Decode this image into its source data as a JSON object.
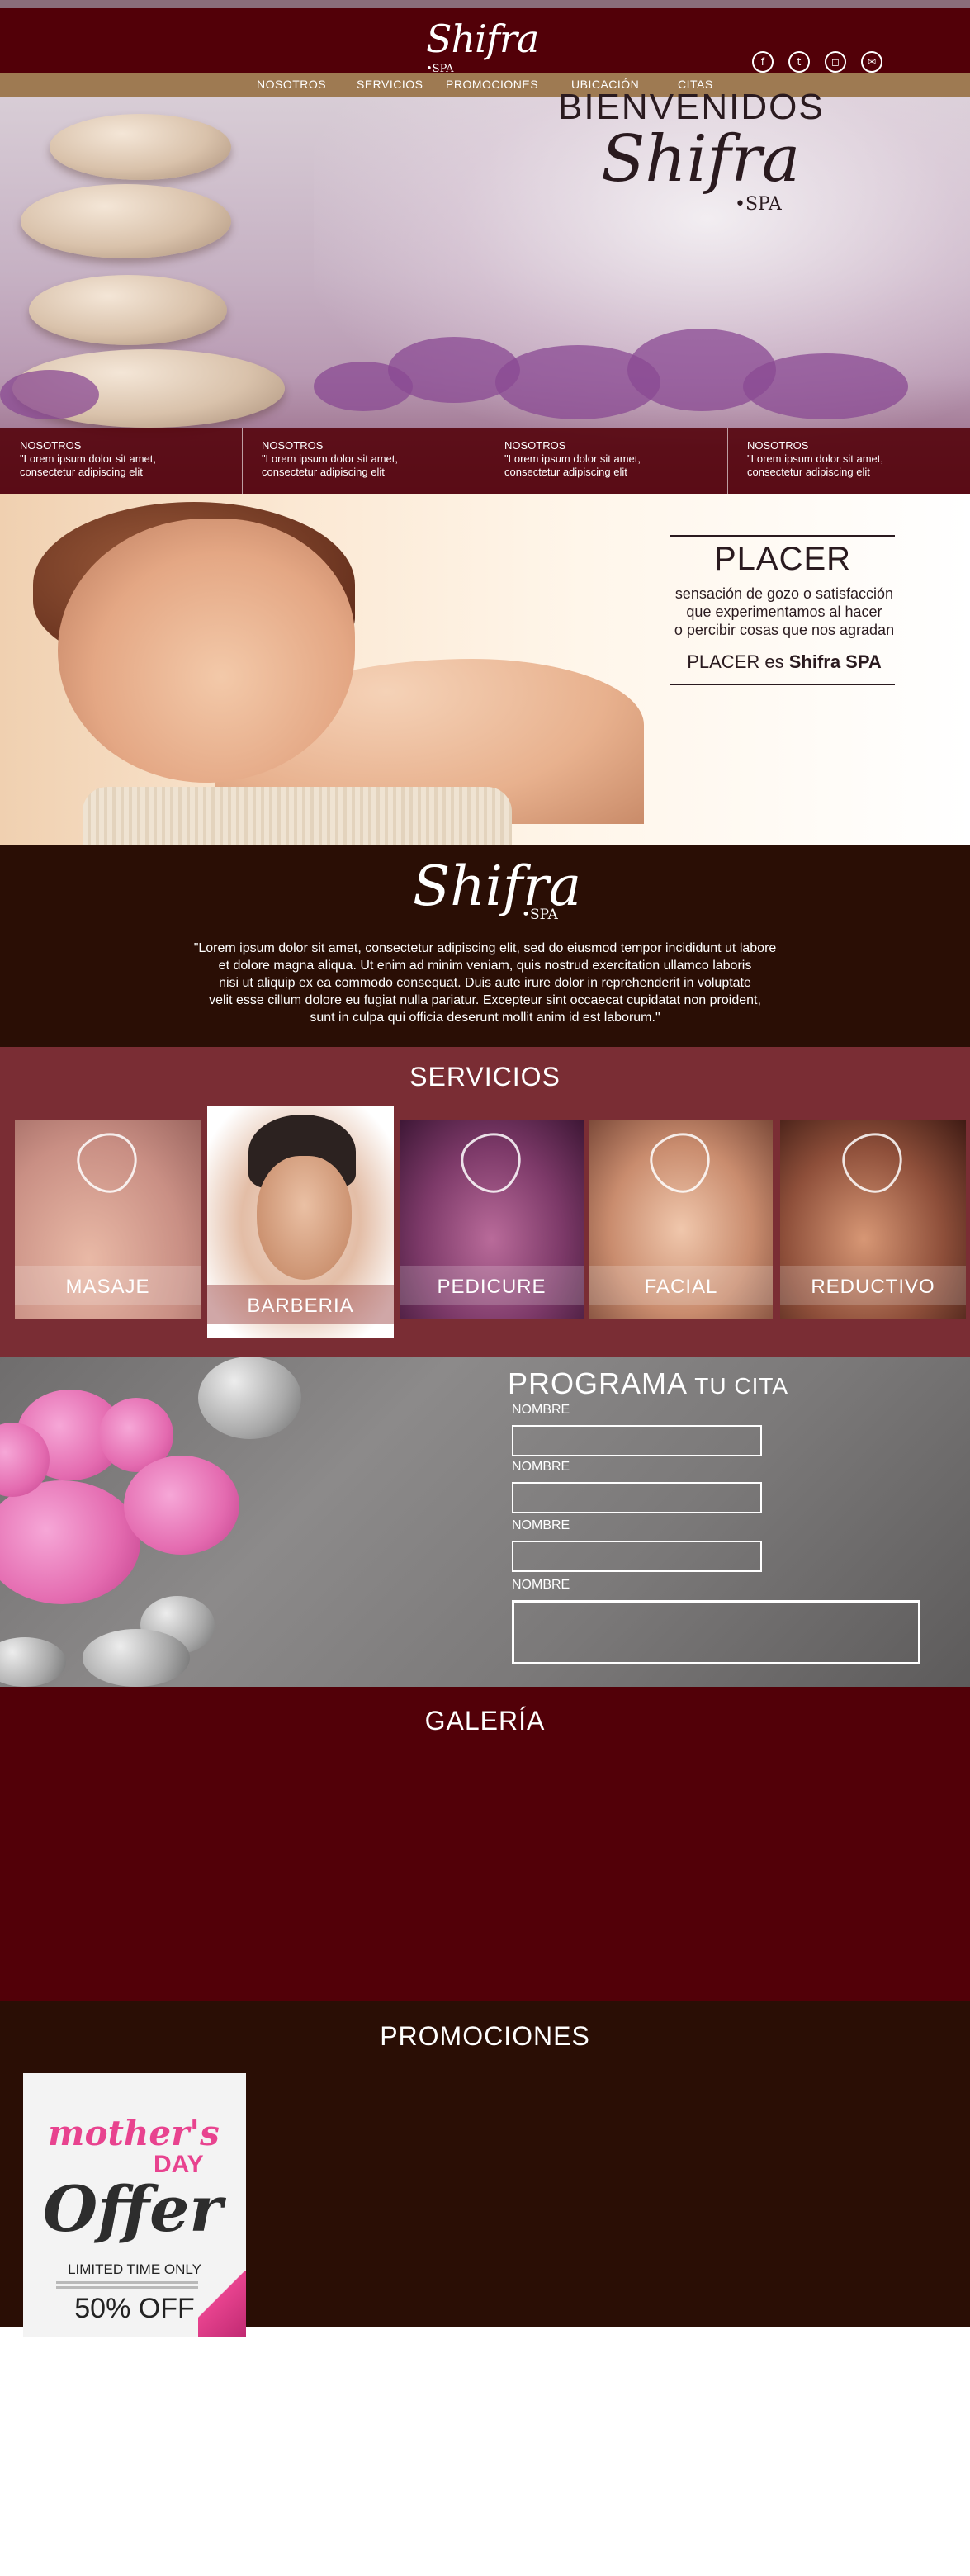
{
  "brand": {
    "name": "Shifra",
    "sub": "•SPA"
  },
  "nav": {
    "items": [
      {
        "label": "NOSOTROS"
      },
      {
        "label": "SERVICIOS"
      },
      {
        "label": "PROMOCIONES"
      },
      {
        "label": "UBICACIÓN"
      },
      {
        "label": "CITAS"
      }
    ]
  },
  "social": {
    "icons": [
      "facebook-icon",
      "twitter-icon",
      "instagram-icon",
      "email-icon"
    ]
  },
  "hero": {
    "title": "BIENVENIDOS",
    "logo": "Shifra",
    "logo_sub": "•SPA"
  },
  "features": [
    {
      "title": "NOSOTROS",
      "line1": "\"Lorem ipsum dolor sit amet,",
      "line2": "consectetur adipiscing elit"
    },
    {
      "title": "NOSOTROS",
      "line1": "\"Lorem ipsum dolor sit amet,",
      "line2": "consectetur adipiscing elit"
    },
    {
      "title": "NOSOTROS",
      "line1": "\"Lorem ipsum dolor sit amet,",
      "line2": "consectetur adipiscing elit"
    },
    {
      "title": "NOSOTROS",
      "line1": "\"Lorem ipsum dolor sit amet,",
      "line2": "consectetur adipiscing elit"
    }
  ],
  "placer": {
    "title": "PLACER",
    "desc1": "sensación de gozo o satisfacción",
    "desc2": "que experimentamos al hacer",
    "desc3": "o percibir cosas que nos agradan",
    "tag_prefix": "PLACER es ",
    "tag_brand": "Shifra SPA"
  },
  "about": {
    "logo": "Shifra",
    "logo_sub": "•SPA",
    "line1": "\"Lorem ipsum dolor sit amet, consectetur adipiscing elit, sed do eiusmod tempor incididunt ut labore",
    "line2": "et dolore magna aliqua. Ut enim ad minim veniam, quis nostrud exercitation ullamco laboris",
    "line3": "nisi ut aliquip ex ea commodo consequat. Duis aute irure dolor in reprehenderit in voluptate",
    "line4": "velit esse cillum dolore eu fugiat nulla pariatur. Excepteur sint occaecat cupidatat non proident,",
    "line5": "sunt in culpa qui officia deserunt mollit anim id est laborum.\""
  },
  "services": {
    "title": "SERVICIOS",
    "items": [
      {
        "label": "MASAJE",
        "icon": "lotus-icon"
      },
      {
        "label": "BARBERIA",
        "icon": ""
      },
      {
        "label": "PEDICURE",
        "icon": "leaf-icon"
      },
      {
        "label": "FACIAL",
        "icon": "flower-icon"
      },
      {
        "label": "REDUCTIVO",
        "icon": "drop-icon"
      }
    ]
  },
  "cita": {
    "title_main": "PROGRAMA",
    "title_sub": " TU CITA",
    "fields": [
      "NOMBRE",
      "NOMBRE",
      "NOMBRE",
      "NOMBRE"
    ]
  },
  "galeria": {
    "title": "GALERÍA"
  },
  "promociones": {
    "title": "PROMOCIONES",
    "card": {
      "mothers": "mother's",
      "day": "DAY",
      "offer": "Offer",
      "limited": "LIMITED TIME ONLY",
      "off": "50% OFF"
    }
  },
  "colors": {
    "header": "#520008",
    "nav": "#9e7a52",
    "services": "#7a2d34",
    "dark": "#2a0e05",
    "accent_pink": "#e8438f"
  }
}
